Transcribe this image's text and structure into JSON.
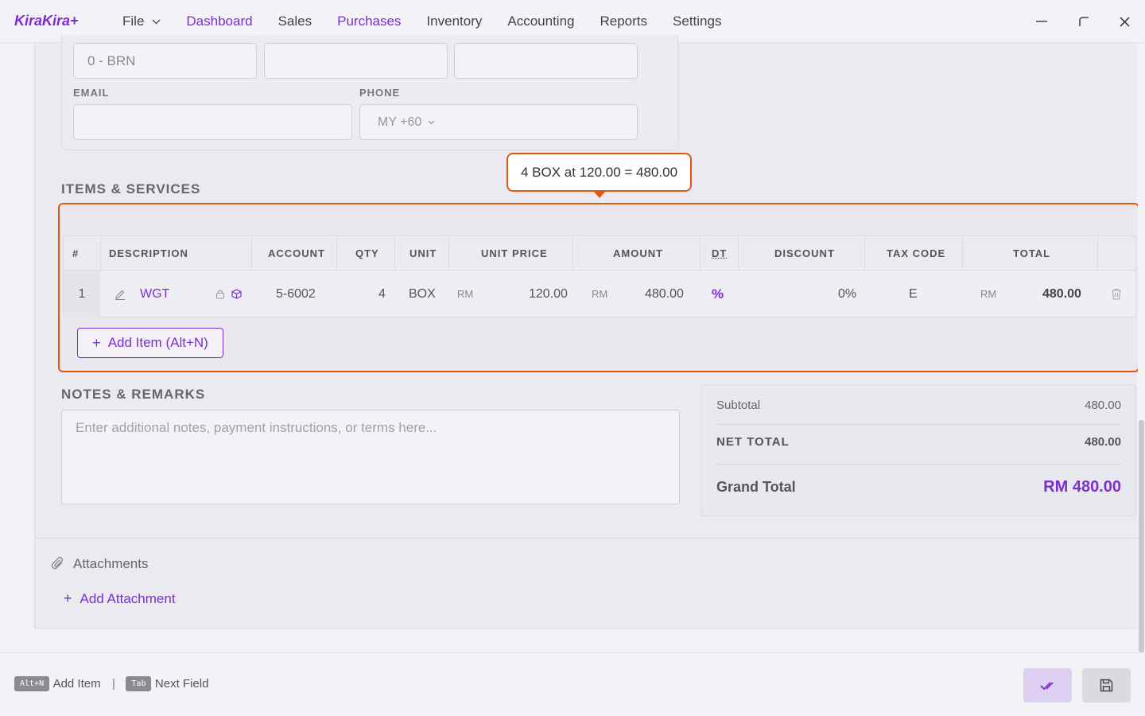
{
  "app": {
    "brand": "KiraKira+"
  },
  "nav": {
    "file": "File",
    "items": [
      "Dashboard",
      "Sales",
      "Purchases",
      "Inventory",
      "Accounting",
      "Reports",
      "Settings"
    ],
    "active": "Purchases"
  },
  "contact": {
    "brn_value": "0 - BRN",
    "email_label": "EMAIL",
    "email_value": "",
    "phone_label": "PHONE",
    "phone_country": "MY +60"
  },
  "tooltip": {
    "text": "4 BOX at 120.00 = 480.00"
  },
  "items_section": {
    "title": "ITEMS & SERVICES",
    "headers": {
      "num": "#",
      "description": "DESCRIPTION",
      "account": "ACCOUNT",
      "qty": "QTY",
      "unit": "UNIT",
      "unit_price": "UNIT PRICE",
      "amount": "AMOUNT",
      "dt": "DT",
      "discount": "DISCOUNT",
      "tax_code": "TAX CODE",
      "total": "TOTAL"
    },
    "rows": [
      {
        "num": "1",
        "description": "WGT",
        "account": "5-6002",
        "qty": "4",
        "unit": "BOX",
        "currency": "RM",
        "unit_price": "120.00",
        "amount": "480.00",
        "dt_symbol": "%",
        "discount": "0%",
        "tax_code": "E",
        "total": "480.00"
      }
    ],
    "add_item_label": "Add Item (Alt+N)"
  },
  "notes": {
    "title": "NOTES & REMARKS",
    "placeholder": "Enter additional notes, payment instructions, or terms here..."
  },
  "totals": {
    "subtotal_label": "Subtotal",
    "subtotal_value": "480.00",
    "net_total_label": "NET TOTAL",
    "net_total_value": "480.00",
    "grand_total_label": "Grand Total",
    "grand_total_value": "RM 480.00"
  },
  "attachments": {
    "title": "Attachments",
    "add_label": "Add Attachment"
  },
  "footer": {
    "hint1_key": "Alt+N",
    "hint1_text": "Add Item",
    "separator": "|",
    "hint2_key": "Tab",
    "hint2_text": "Next Field"
  },
  "colors": {
    "accent": "#7b2fd0",
    "highlight": "#e1580f"
  }
}
